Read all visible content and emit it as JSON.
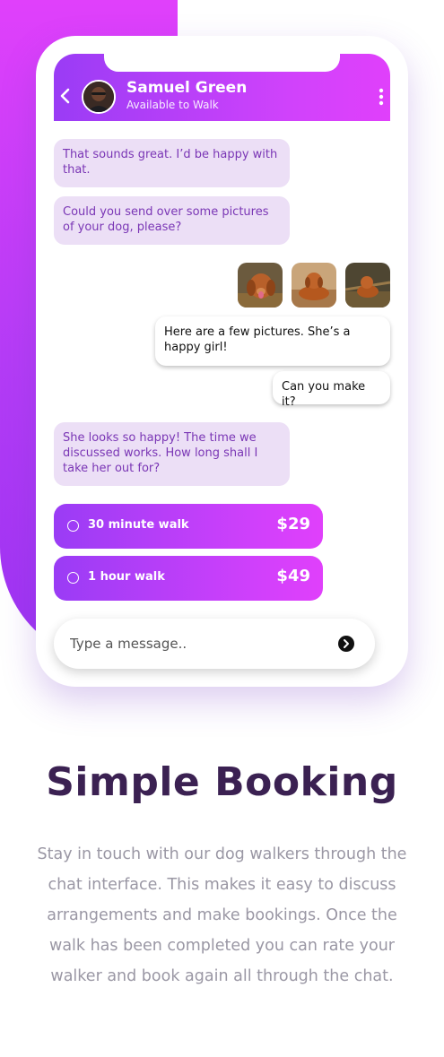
{
  "chat": {
    "contact_name": "Samuel Green",
    "contact_status": "Available to Walk",
    "messages": {
      "m1": "That sounds great. I’d be happy with that.",
      "m2": "Could you send over some pictures of your dog, please?",
      "m3": "Here are a few pictures. She’s a happy girl!",
      "m4": "Can you make it?",
      "m5": "She looks so happy! The time we discussed works. How long shall I take her out for?"
    },
    "photos_count": 3,
    "options": [
      {
        "label": "30 minute walk",
        "price": "$29"
      },
      {
        "label": "1 hour walk",
        "price": "$49"
      }
    ],
    "input_placeholder": "Type a message.."
  },
  "feature": {
    "title": "Simple Booking",
    "description": "Stay in touch with our dog walkers through the chat interface. This makes it easy to discuss arrangements and make bookings. Once the walk has been completed you can rate your walker and book again all through the chat."
  },
  "colors": {
    "accent_purple": "#9a3cf5",
    "accent_magenta": "#e040fb",
    "bubble_incoming": "#ecdff6",
    "bubble_text": "#7a36b5",
    "title": "#3b2152",
    "body_text": "#9a97a4"
  },
  "icons": {
    "back": "chevron-left-icon",
    "more": "more-vertical-icon",
    "send": "send-arrow-icon",
    "radio": "radio-unchecked-icon"
  }
}
